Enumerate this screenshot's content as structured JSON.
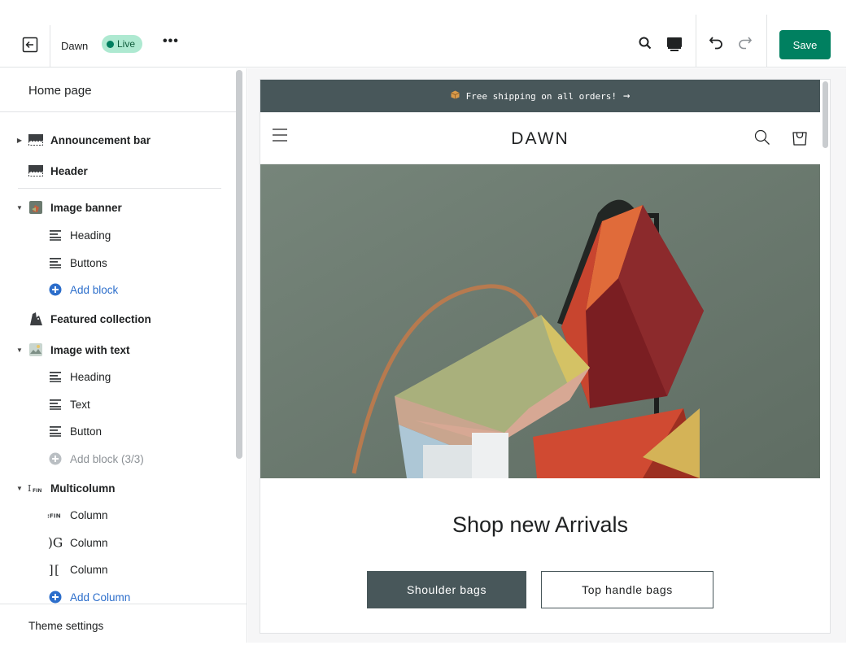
{
  "topbar": {
    "theme_name": "Dawn",
    "live_badge": "Live",
    "more_label": "•••",
    "save_label": "Save",
    "icons": [
      "exit-icon",
      "search-icon",
      "desktop-icon",
      "undo-icon",
      "redo-icon"
    ]
  },
  "sidebar": {
    "title": "Home page",
    "items": [
      {
        "label": "Announcement bar",
        "kind": "section",
        "expanded": false
      },
      {
        "label": "Header",
        "kind": "section"
      },
      {
        "label": "Image banner",
        "kind": "section",
        "expanded": true
      },
      {
        "label": "Heading",
        "kind": "block"
      },
      {
        "label": "Buttons",
        "kind": "block"
      },
      {
        "label": "Add block",
        "kind": "add"
      },
      {
        "label": "Featured collection",
        "kind": "section"
      },
      {
        "label": "Image with text",
        "kind": "section",
        "expanded": true
      },
      {
        "label": "Heading",
        "kind": "block"
      },
      {
        "label": "Text",
        "kind": "block"
      },
      {
        "label": "Button",
        "kind": "block"
      },
      {
        "label": "Add block (3/3)",
        "kind": "add",
        "disabled": true
      },
      {
        "label": "Multicolumn",
        "kind": "section",
        "expanded": true
      },
      {
        "label": "Column",
        "kind": "block",
        "thumb": "FIN"
      },
      {
        "label": "Column",
        "kind": "block",
        "thumb": "OG"
      },
      {
        "label": "Column",
        "kind": "block",
        "thumb": "CU"
      },
      {
        "label": "Add Column",
        "kind": "add"
      }
    ],
    "footer": "Theme settings"
  },
  "preview": {
    "announcement": "Free shipping on all orders!",
    "announcement_arrow": "→",
    "logo": "DAWN",
    "heading": "Shop new Arrivals",
    "button_primary": "Shoulder bags",
    "button_secondary": "Top handle bags"
  },
  "colors": {
    "save": "#008060",
    "live_badge": "#aee9d1",
    "link": "#2c6ecb",
    "store_accent": "#48575a",
    "banner_bg": "#6b7a6f"
  }
}
